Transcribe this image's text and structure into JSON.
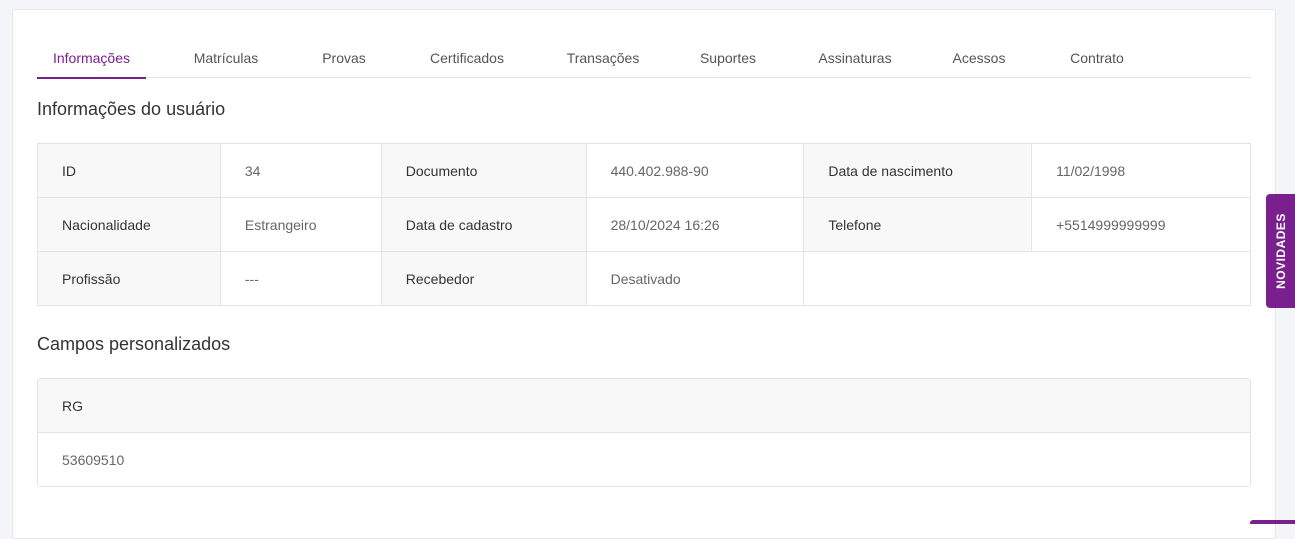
{
  "tabs": [
    {
      "label": "Informações",
      "active": true
    },
    {
      "label": "Matrículas"
    },
    {
      "label": "Provas"
    },
    {
      "label": "Certificados"
    },
    {
      "label": "Transações"
    },
    {
      "label": "Suportes"
    },
    {
      "label": "Assinaturas"
    },
    {
      "label": "Acessos"
    },
    {
      "label": "Contrato"
    }
  ],
  "user_info": {
    "title": "Informações do usuário",
    "fields": {
      "id": {
        "label": "ID",
        "value": "34"
      },
      "documento": {
        "label": "Documento",
        "value": "440.402.988-90"
      },
      "nascimento": {
        "label": "Data de nascimento",
        "value": "11/02/1998"
      },
      "nacionalidade": {
        "label": "Nacionalidade",
        "value": "Estrangeiro"
      },
      "cadastro": {
        "label": "Data de cadastro",
        "value": "28/10/2024 16:26"
      },
      "telefone": {
        "label": "Telefone",
        "value": "+5514999999999"
      },
      "profissao": {
        "label": "Profissão",
        "value": "---"
      },
      "recebedor": {
        "label": "Recebedor",
        "value": "Desativado"
      }
    }
  },
  "custom_fields": {
    "title": "Campos personalizados",
    "items": [
      {
        "label": "RG",
        "value": "53609510"
      }
    ]
  },
  "novidades_label": "NOVIDADES",
  "colors": {
    "accent": "#7a1f8e",
    "border": "#e4e4e4",
    "label_bg": "#f8f8f8"
  }
}
